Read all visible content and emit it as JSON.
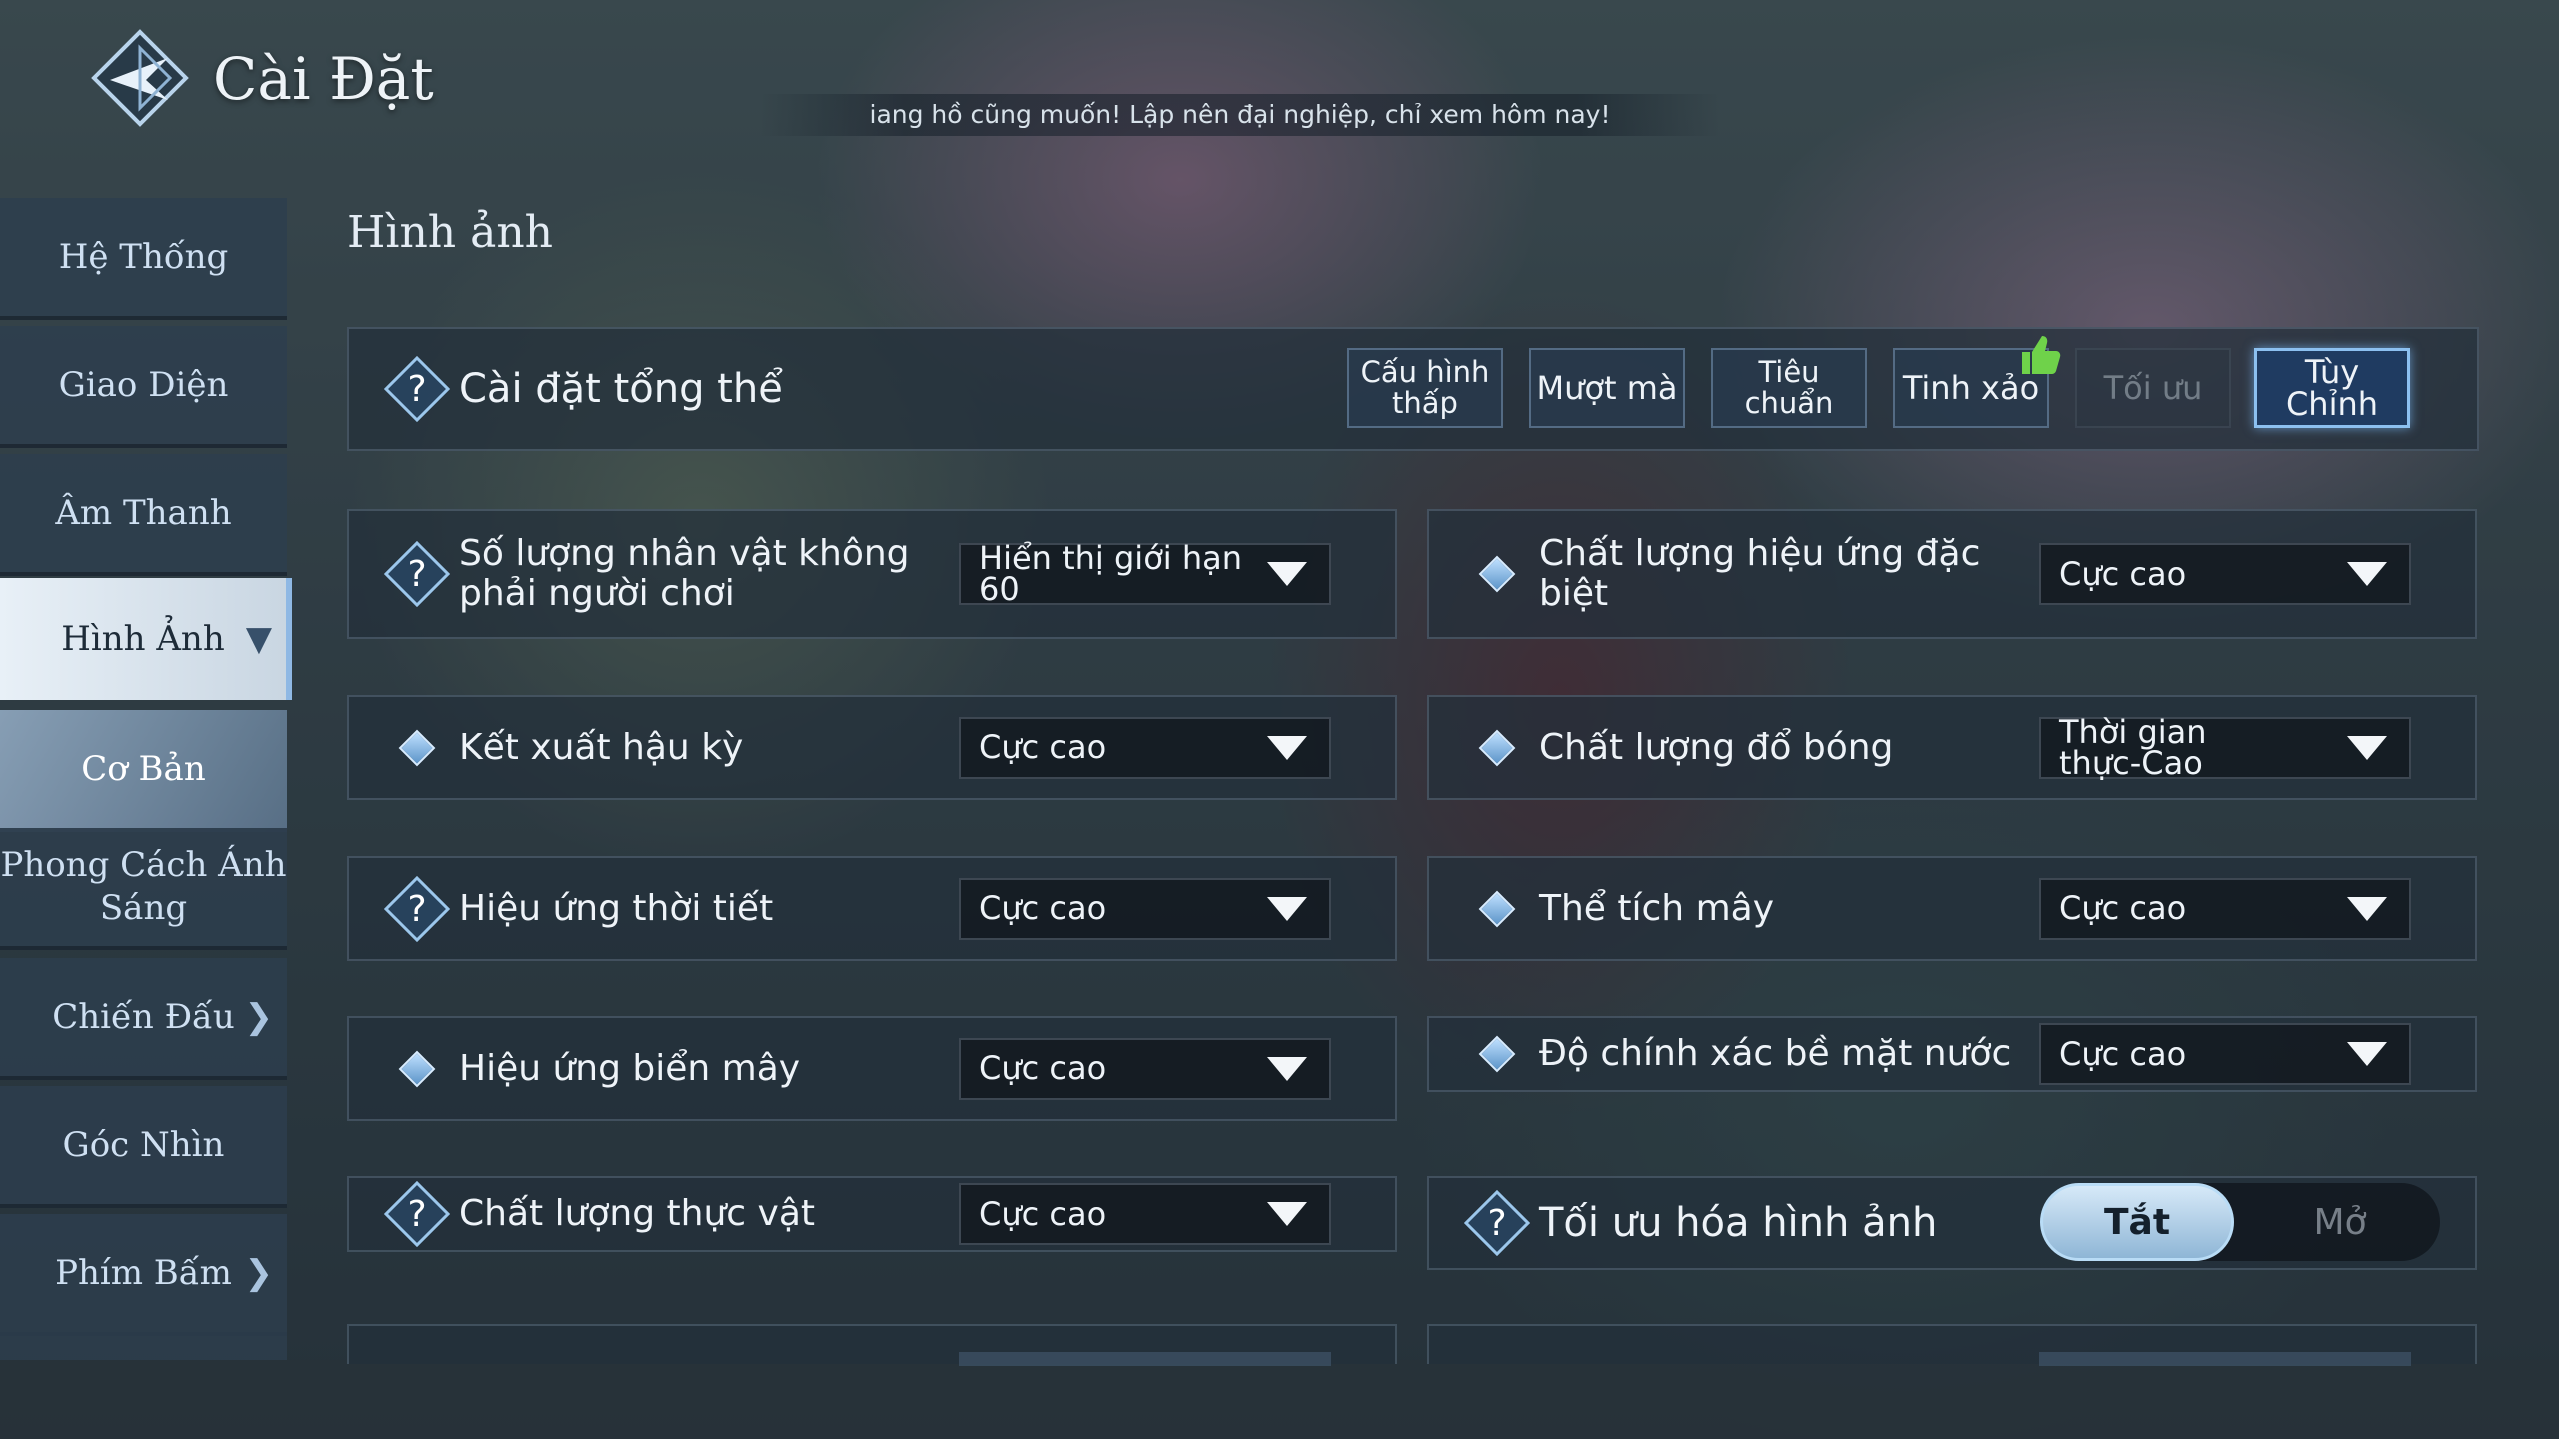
{
  "header": {
    "title": "Cài Đặt",
    "ticker": "iang hồ cũng muốn! Lập nên đại nghiệp, chỉ xem hôm nay!"
  },
  "sidebar": {
    "items": [
      {
        "label": "Hệ Thống"
      },
      {
        "label": "Giao Diện"
      },
      {
        "label": "Âm Thanh"
      },
      {
        "label": "Hình Ảnh"
      },
      {
        "label": "Cơ Bản"
      },
      {
        "label": "Phong Cách Ánh Sáng"
      },
      {
        "label": "Chiến Đấu"
      },
      {
        "label": "Góc Nhìn"
      },
      {
        "label": "Phím Bấm"
      }
    ]
  },
  "main": {
    "section_title": "Hình ảnh",
    "overall": {
      "label": "Cài đặt tổng thể",
      "presets": [
        "Cấu hình thấp",
        "Mượt mà",
        "Tiêu chuẩn",
        "Tinh xảo",
        "Tối ưu",
        "Tùy Chỉnh"
      ],
      "selected": "Tùy Chỉnh",
      "recommended": "Tinh xảo"
    },
    "left": [
      {
        "label": "Số lượng nhân vật không phải người chơi",
        "value": "Hiển thị giới hạn 60",
        "icon": "question-icon"
      },
      {
        "label": "Kết xuất hậu kỳ",
        "value": "Cực cao",
        "icon": "diamond-icon"
      },
      {
        "label": "Hiệu ứng thời tiết",
        "value": "Cực cao",
        "icon": "question-icon"
      },
      {
        "label": "Hiệu ứng biển mây",
        "value": "Cực cao",
        "icon": "diamond-icon"
      },
      {
        "label": "Chất lượng thực vật",
        "value": "Cực cao",
        "icon": "question-icon"
      }
    ],
    "right": [
      {
        "label": "Chất lượng hiệu ứng đặc biệt",
        "value": "Cực cao",
        "icon": "diamond-icon"
      },
      {
        "label": "Chất lượng đổ bóng",
        "value": "Thời gian thực-Cao",
        "icon": "diamond-icon"
      },
      {
        "label": "Thể tích mây",
        "value": "Cực cao",
        "icon": "diamond-icon"
      },
      {
        "label": "Độ chính xác bề mặt nước",
        "value": "Cực cao",
        "icon": "diamond-icon"
      }
    ],
    "image_optimization": {
      "label": "Tối ưu hóa hình ảnh",
      "off_label": "Tắt",
      "on_label": "Mở",
      "state": "off"
    }
  },
  "colors": {
    "accent": "#8cc0f0",
    "active_nav": "#e8f0f7",
    "panel": "#23303b"
  }
}
